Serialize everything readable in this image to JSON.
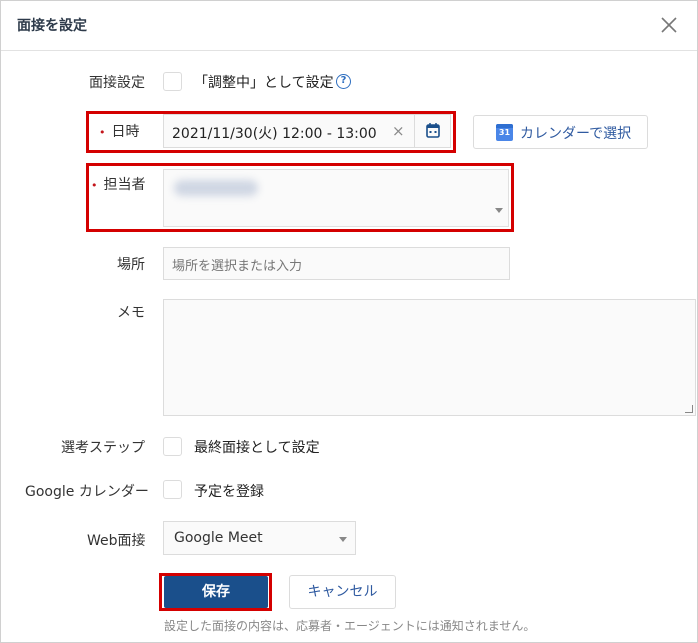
{
  "dialog": {
    "title": "面接を設定"
  },
  "fields": {
    "interview_setting": {
      "label": "面接設定",
      "checkbox_text": "「調整中」として設定"
    },
    "datetime": {
      "label": "日時",
      "value": "2021/11/30(火) 12:00 - 13:00",
      "clear_symbol": "×"
    },
    "calendar_button": {
      "label": "カレンダーで選択",
      "icon_number": "31"
    },
    "assignee": {
      "label": "担当者"
    },
    "location": {
      "label": "場所",
      "placeholder": "場所を選択または入力"
    },
    "memo": {
      "label": "メモ"
    },
    "selection_step": {
      "label": "選考ステップ",
      "checkbox_text": "最終面接として設定"
    },
    "google_calendar": {
      "label": "Google カレンダー",
      "checkbox_text": "予定を登録"
    },
    "web_interview": {
      "label": "Web面接",
      "value": "Google Meet"
    }
  },
  "footer": {
    "save_label": "保存",
    "cancel_label": "キャンセル",
    "note": "設定した面接の内容は、応募者・エージェントには通知されません。"
  },
  "icons": {
    "help": "?",
    "required_marker": "•"
  },
  "colors": {
    "primary": "#1a4f8b",
    "link": "#2f5aa0",
    "highlight": "#d40000",
    "required": "#c4161c"
  }
}
